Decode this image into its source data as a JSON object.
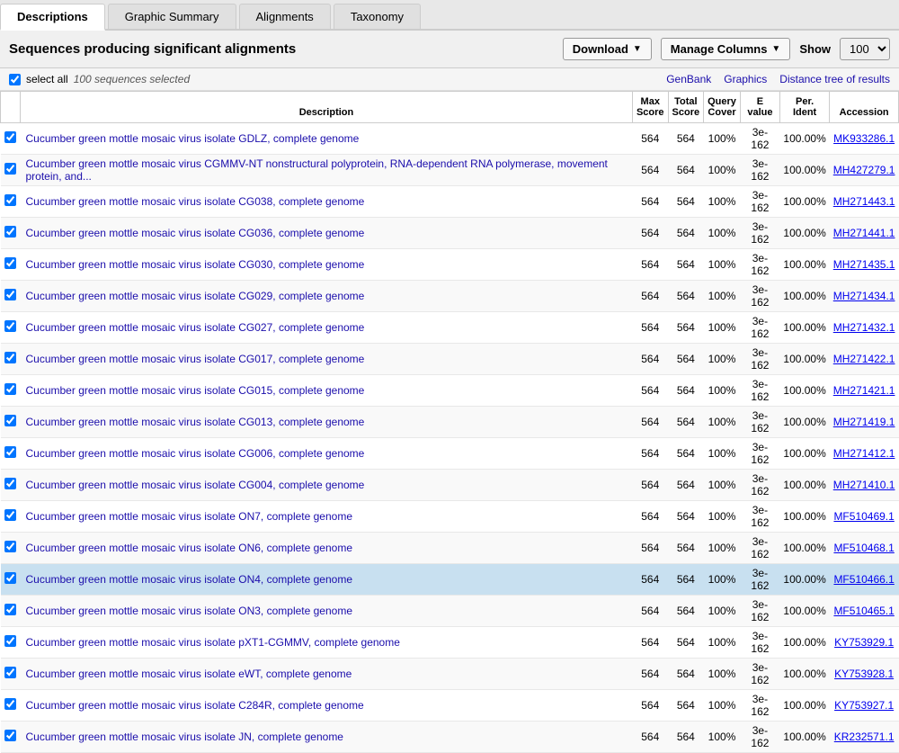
{
  "tabs": [
    {
      "label": "Descriptions",
      "active": true
    },
    {
      "label": "Graphic Summary",
      "active": false
    },
    {
      "label": "Alignments",
      "active": false
    },
    {
      "label": "Taxonomy",
      "active": false
    }
  ],
  "header": {
    "title": "Sequences producing significant alignments",
    "download_label": "Download",
    "manage_columns_label": "Manage Columns",
    "show_label": "Show",
    "show_value": "100"
  },
  "toolbar": {
    "select_all_label": "select all",
    "sequences_selected": "100 sequences selected",
    "genbank_label": "GenBank",
    "graphics_label": "Graphics",
    "distance_tree_label": "Distance tree of results"
  },
  "table": {
    "columns": [
      {
        "key": "checkbox",
        "label": ""
      },
      {
        "key": "description",
        "label": "Description"
      },
      {
        "key": "max_score",
        "label": "Max\nScore"
      },
      {
        "key": "total_score",
        "label": "Total\nScore"
      },
      {
        "key": "query_cover",
        "label": "Query\nCover"
      },
      {
        "key": "e_value",
        "label": "E\nvalue"
      },
      {
        "key": "per_ident",
        "label": "Per.\nIdent"
      },
      {
        "key": "accession",
        "label": "Accession"
      }
    ],
    "rows": [
      {
        "description": "Cucumber green mottle mosaic virus isolate GDLZ, complete genome",
        "max_score": "564",
        "total_score": "564",
        "query_cover": "100%",
        "e_value": "3e-162",
        "per_ident": "100.00%",
        "accession": "MK933286.1",
        "highlighted": false
      },
      {
        "description": "Cucumber green mottle mosaic virus CGMMV-NT nonstructural polyprotein, RNA-dependent RNA polymerase, movement protein, and...",
        "max_score": "564",
        "total_score": "564",
        "query_cover": "100%",
        "e_value": "3e-162",
        "per_ident": "100.00%",
        "accession": "MH427279.1",
        "highlighted": false
      },
      {
        "description": "Cucumber green mottle mosaic virus isolate CG038, complete genome",
        "max_score": "564",
        "total_score": "564",
        "query_cover": "100%",
        "e_value": "3e-162",
        "per_ident": "100.00%",
        "accession": "MH271443.1",
        "highlighted": false
      },
      {
        "description": "Cucumber green mottle mosaic virus isolate CG036, complete genome",
        "max_score": "564",
        "total_score": "564",
        "query_cover": "100%",
        "e_value": "3e-162",
        "per_ident": "100.00%",
        "accession": "MH271441.1",
        "highlighted": false
      },
      {
        "description": "Cucumber green mottle mosaic virus isolate CG030, complete genome",
        "max_score": "564",
        "total_score": "564",
        "query_cover": "100%",
        "e_value": "3e-162",
        "per_ident": "100.00%",
        "accession": "MH271435.1",
        "highlighted": false
      },
      {
        "description": "Cucumber green mottle mosaic virus isolate CG029, complete genome",
        "max_score": "564",
        "total_score": "564",
        "query_cover": "100%",
        "e_value": "3e-162",
        "per_ident": "100.00%",
        "accession": "MH271434.1",
        "highlighted": false
      },
      {
        "description": "Cucumber green mottle mosaic virus isolate CG027, complete genome",
        "max_score": "564",
        "total_score": "564",
        "query_cover": "100%",
        "e_value": "3e-162",
        "per_ident": "100.00%",
        "accession": "MH271432.1",
        "highlighted": false
      },
      {
        "description": "Cucumber green mottle mosaic virus isolate CG017, complete genome",
        "max_score": "564",
        "total_score": "564",
        "query_cover": "100%",
        "e_value": "3e-162",
        "per_ident": "100.00%",
        "accession": "MH271422.1",
        "highlighted": false
      },
      {
        "description": "Cucumber green mottle mosaic virus isolate CG015, complete genome",
        "max_score": "564",
        "total_score": "564",
        "query_cover": "100%",
        "e_value": "3e-162",
        "per_ident": "100.00%",
        "accession": "MH271421.1",
        "highlighted": false
      },
      {
        "description": "Cucumber green mottle mosaic virus isolate CG013, complete genome",
        "max_score": "564",
        "total_score": "564",
        "query_cover": "100%",
        "e_value": "3e-162",
        "per_ident": "100.00%",
        "accession": "MH271419.1",
        "highlighted": false
      },
      {
        "description": "Cucumber green mottle mosaic virus isolate CG006, complete genome",
        "max_score": "564",
        "total_score": "564",
        "query_cover": "100%",
        "e_value": "3e-162",
        "per_ident": "100.00%",
        "accession": "MH271412.1",
        "highlighted": false
      },
      {
        "description": "Cucumber green mottle mosaic virus isolate CG004, complete genome",
        "max_score": "564",
        "total_score": "564",
        "query_cover": "100%",
        "e_value": "3e-162",
        "per_ident": "100.00%",
        "accession": "MH271410.1",
        "highlighted": false
      },
      {
        "description": "Cucumber green mottle mosaic virus isolate ON7, complete genome",
        "max_score": "564",
        "total_score": "564",
        "query_cover": "100%",
        "e_value": "3e-162",
        "per_ident": "100.00%",
        "accession": "MF510469.1",
        "highlighted": false
      },
      {
        "description": "Cucumber green mottle mosaic virus isolate ON6, complete genome",
        "max_score": "564",
        "total_score": "564",
        "query_cover": "100%",
        "e_value": "3e-162",
        "per_ident": "100.00%",
        "accession": "MF510468.1",
        "highlighted": false
      },
      {
        "description": "Cucumber green mottle mosaic virus isolate ON4, complete genome",
        "max_score": "564",
        "total_score": "564",
        "query_cover": "100%",
        "e_value": "3e-162",
        "per_ident": "100.00%",
        "accession": "MF510466.1",
        "highlighted": true
      },
      {
        "description": "Cucumber green mottle mosaic virus isolate ON3, complete genome",
        "max_score": "564",
        "total_score": "564",
        "query_cover": "100%",
        "e_value": "3e-162",
        "per_ident": "100.00%",
        "accession": "MF510465.1",
        "highlighted": false
      },
      {
        "description": "Cucumber green mottle mosaic virus isolate pXT1-CGMMV, complete genome",
        "max_score": "564",
        "total_score": "564",
        "query_cover": "100%",
        "e_value": "3e-162",
        "per_ident": "100.00%",
        "accession": "KY753929.1",
        "highlighted": false
      },
      {
        "description": "Cucumber green mottle mosaic virus isolate eWT, complete genome",
        "max_score": "564",
        "total_score": "564",
        "query_cover": "100%",
        "e_value": "3e-162",
        "per_ident": "100.00%",
        "accession": "KY753928.1",
        "highlighted": false
      },
      {
        "description": "Cucumber green mottle mosaic virus isolate C284R, complete genome",
        "max_score": "564",
        "total_score": "564",
        "query_cover": "100%",
        "e_value": "3e-162",
        "per_ident": "100.00%",
        "accession": "KY753927.1",
        "highlighted": false
      },
      {
        "description": "Cucumber green mottle mosaic virus isolate JN, complete genome",
        "max_score": "564",
        "total_score": "564",
        "query_cover": "100%",
        "e_value": "3e-162",
        "per_ident": "100.00%",
        "accession": "KR232571.1",
        "highlighted": false
      }
    ]
  }
}
